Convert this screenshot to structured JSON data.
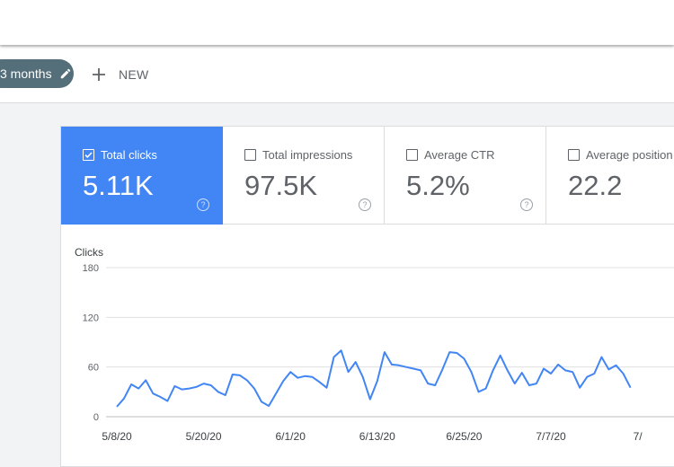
{
  "filter": {
    "date_chip_label": "3 months",
    "new_label": "NEW"
  },
  "icons": {
    "edit": "pencil-icon",
    "add": "plus-icon",
    "check": "checkbox-checked-icon",
    "help": "help-circle-icon"
  },
  "colors": {
    "accent": "#4285f4",
    "chip": "#546e7a",
    "line": "#4285f4",
    "grid": "#e0e0e0"
  },
  "metrics": [
    {
      "label": "Total clicks",
      "value": "5.11K",
      "checked": true
    },
    {
      "label": "Total impressions",
      "value": "97.5K",
      "checked": false
    },
    {
      "label": "Average CTR",
      "value": "5.2%",
      "checked": false
    },
    {
      "label": "Average position",
      "value": "22.2",
      "checked": false
    }
  ],
  "chart_data": {
    "type": "line",
    "ylabel": "Clicks",
    "ylim": [
      0,
      180
    ],
    "yticks": [
      "0",
      "60",
      "120",
      "180"
    ],
    "xticks": [
      "5/8/20",
      "5/20/20",
      "6/1/20",
      "6/13/20",
      "6/25/20",
      "7/7/20",
      "7/"
    ],
    "grid": true,
    "series": [
      {
        "values": [
          12,
          22,
          39,
          34,
          44,
          28,
          24,
          19,
          37,
          33,
          34,
          36,
          40,
          38,
          30,
          26,
          51,
          50,
          44,
          34,
          18,
          13,
          28,
          43,
          54,
          47,
          49,
          48,
          42,
          35,
          72,
          80,
          54,
          66,
          48,
          21,
          43,
          78,
          63,
          62,
          60,
          58,
          56,
          40,
          38,
          57,
          78,
          77,
          70,
          54,
          30,
          34,
          56,
          74,
          56,
          40,
          53,
          38,
          40,
          58,
          52,
          63,
          56,
          54,
          35,
          48,
          52,
          72,
          57,
          62,
          52,
          35
        ]
      }
    ]
  }
}
